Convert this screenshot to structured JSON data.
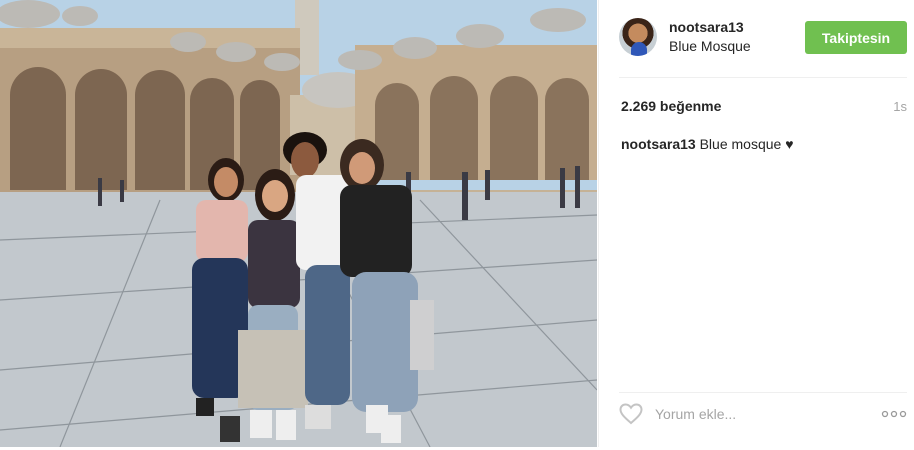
{
  "post": {
    "photo_alt": "Four women posing in the courtyard of the Blue Mosque"
  },
  "header": {
    "username": "nootsara13",
    "location": "Blue Mosque",
    "follow_label": "Takiptesin"
  },
  "stats": {
    "likes": "2.269 beğenme",
    "time": "1s"
  },
  "caption": {
    "username": "nootsara13",
    "text": "Blue mosque ♥"
  },
  "comment": {
    "placeholder": "Yorum ekle..."
  },
  "colors": {
    "follow_button": "#70c050",
    "text": "#262626",
    "muted": "#a5a5a5"
  }
}
